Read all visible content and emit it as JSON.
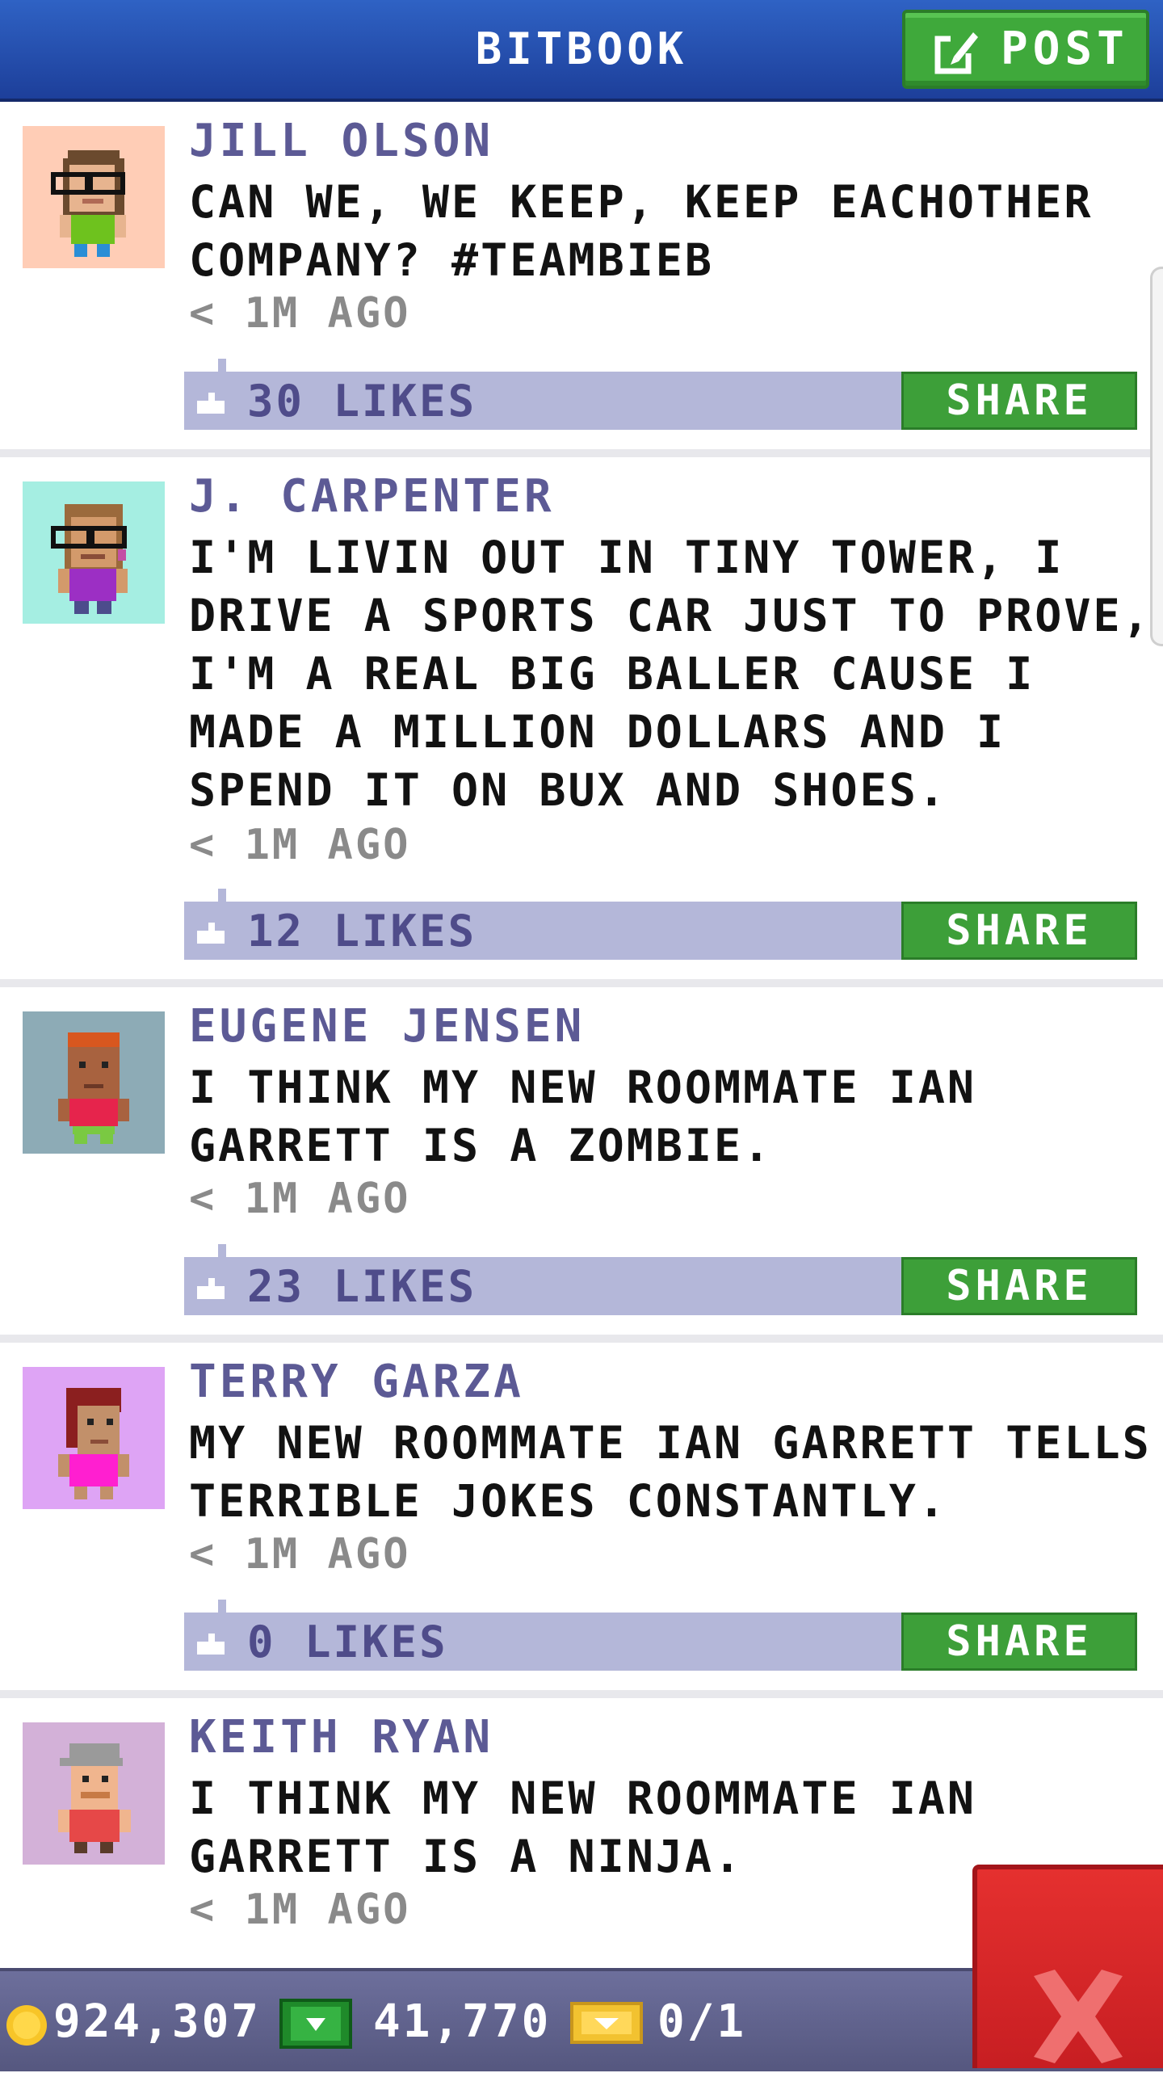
{
  "header": {
    "title": "BITBOOK",
    "post_label": "POST"
  },
  "posts": [
    {
      "author": "JILL OLSON",
      "text": "CAN WE, WE KEEP, KEEP EACHOTHER COMPANY? #TEAMBIEB",
      "time": "< 1M AGO",
      "likes": "30 LIKES",
      "share": "SHARE",
      "avatar_bg": "#ffcdb6"
    },
    {
      "author": "J. CARPENTER",
      "text": "I'M LIVIN OUT IN TINY TOWER, I DRIVE A SPORTS CAR JUST TO PROVE, I'M A REAL BIG BALLER CAUSE I MADE A MILLION DOLLARS AND I SPEND IT ON BUX AND SHOES.",
      "time": "< 1M AGO",
      "likes": "12 LIKES",
      "share": "SHARE",
      "avatar_bg": "#a5eee2"
    },
    {
      "author": "EUGENE JENSEN",
      "text": "I THINK MY NEW ROOMMATE IAN GARRETT IS A ZOMBIE.",
      "time": "< 1M AGO",
      "likes": "23 LIKES",
      "share": "SHARE",
      "avatar_bg": "#8dabb6"
    },
    {
      "author": "TERRY GARZA",
      "text": "MY NEW ROOMMATE IAN GARRETT TELLS TERRIBLE JOKES CONSTANTLY.",
      "time": "< 1M AGO",
      "likes": "0 LIKES",
      "share": "SHARE",
      "avatar_bg": "#dea4f5"
    },
    {
      "author": "KEITH RYAN",
      "text": "I THINK MY NEW ROOMMATE IAN GARRETT IS A NINJA.",
      "time": "< 1M AGO",
      "avatar_bg": "#d3b1d8"
    }
  ],
  "status": {
    "coins": "924,307",
    "bux": "41,770",
    "tickets": "0/1"
  },
  "colors": {
    "header": "#2852b5",
    "accent_green": "#3fa93b",
    "author": "#5c5a95",
    "like_bar": "#b4b7d9",
    "close": "#d8262a"
  },
  "icons": {
    "post": "compose-icon",
    "like": "thumbs-up-icon",
    "coin": "coin-icon",
    "bux": "bux-icon",
    "ticket": "vip-ticket-icon",
    "close": "close-icon"
  }
}
